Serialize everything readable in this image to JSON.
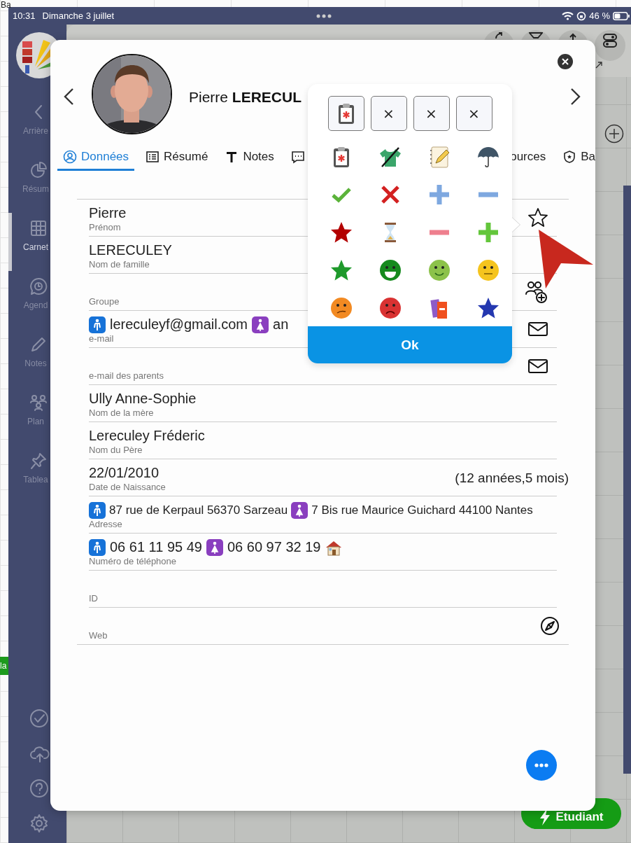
{
  "outer_page": {
    "corner_text": "Ba",
    "cell_text": "la"
  },
  "status_bar": {
    "time": "10:31",
    "date": "Dimanche 3 juillet",
    "battery": "46 %"
  },
  "sidebar": {
    "items": [
      {
        "label": "Arrière",
        "selected": false
      },
      {
        "label": "Résum",
        "selected": false
      },
      {
        "label": "Carnet",
        "selected": true
      },
      {
        "label": "Agend",
        "selected": false
      },
      {
        "label": "Notes",
        "selected": false
      },
      {
        "label": "Plan",
        "selected": false
      },
      {
        "label": "Tablea",
        "selected": false
      }
    ]
  },
  "action_button": {
    "label": "Etudiant"
  },
  "student_card": {
    "first_name": "Pierre",
    "last_name": "LERECUL",
    "tabs": [
      {
        "label": "Données",
        "selected": true
      },
      {
        "label": "Résumé",
        "selected": false
      },
      {
        "label": "Notes",
        "selected": false
      },
      {
        "selected": false
      },
      {
        "label": "ources",
        "selected": false
      },
      {
        "label": "Ba",
        "selected": false
      }
    ],
    "fields": [
      {
        "kind": "favorite",
        "value": "Pierre",
        "label": "Prénom"
      },
      {
        "kind": "plain",
        "value": "LERECULEY",
        "label": "Nom de famille"
      },
      {
        "kind": "group",
        "label": "Groupe"
      },
      {
        "kind": "email",
        "parts": [
          {
            "kind": "male"
          },
          {
            "text": "lereculeyf@gmail.com"
          },
          {
            "kind": "female"
          },
          {
            "text": "an"
          }
        ],
        "label": "e-mail"
      },
      {
        "kind": "email",
        "label": "e-mail des parents"
      },
      {
        "kind": "plain",
        "value": "Ully Anne-Sophie",
        "label": "Nom de la mère"
      },
      {
        "kind": "plain",
        "value": "Lereculey Fréderic",
        "label": "Nom du Père"
      },
      {
        "kind": "plain",
        "value": "22/01/2010",
        "label": "Date de Naissance",
        "aside": "(12 années,5 mois)"
      },
      {
        "kind": "plain",
        "parts": [
          {
            "kind": "male"
          },
          {
            "text": "87 rue de Kerpaul 56370 Sarzeau"
          },
          {
            "kind": "female"
          },
          {
            "text": "7 Bis rue Maurice Guichard 44100 Nantes"
          }
        ],
        "label": "Adresse"
      },
      {
        "kind": "plain",
        "parts": [
          {
            "kind": "male"
          },
          {
            "text": "06 61 11 95 49"
          },
          {
            "kind": "female"
          },
          {
            "text": "06 60 97 32 19"
          },
          {
            "kind": "house"
          }
        ],
        "label": "Numéro de téléphone"
      },
      {
        "kind": "plain",
        "label": "ID"
      },
      {
        "kind": "web",
        "label": "Web"
      }
    ]
  },
  "icon_picker": {
    "slots": [
      {
        "kind": "icon"
      },
      {
        "kind": "empty",
        "label": "×"
      },
      {
        "kind": "empty",
        "label": "×"
      },
      {
        "kind": "empty",
        "label": "×"
      }
    ],
    "button": "Ok"
  }
}
